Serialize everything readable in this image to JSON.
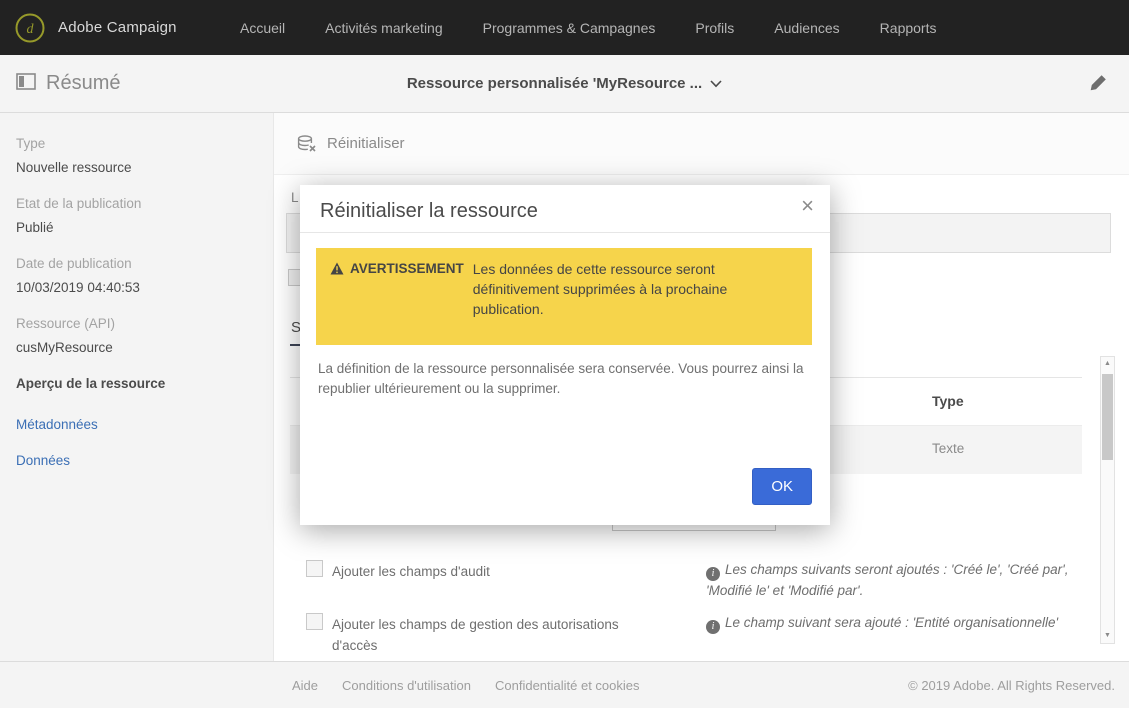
{
  "topbar": {
    "brand": "Adobe Campaign",
    "nav": [
      {
        "label": "Accueil"
      },
      {
        "label": "Activités marketing"
      },
      {
        "label": "Programmes & Campagnes"
      },
      {
        "label": "Profils"
      },
      {
        "label": "Audiences"
      },
      {
        "label": "Rapports"
      }
    ]
  },
  "header": {
    "section": "Résumé",
    "title": "Ressource personnalisée 'MyResource ..."
  },
  "sidebar": {
    "fields": [
      {
        "label": "Type",
        "value": "Nouvelle ressource"
      },
      {
        "label": "Etat de la publication",
        "value": "Publié"
      },
      {
        "label": "Date de publication",
        "value": "10/03/2019 04:40:53"
      },
      {
        "label": "Ressource (API)",
        "value": "cusMyResource"
      }
    ],
    "section_title": "Aperçu de la ressource",
    "links": [
      {
        "label": "Métadonnées"
      },
      {
        "label": "Données"
      }
    ]
  },
  "main": {
    "action": "Réinitialiser",
    "field_label": "L",
    "tab_label": "S",
    "table": {
      "type_header": "Type",
      "type_cell": "Texte"
    },
    "options": [
      {
        "label": "Ajouter les champs d'audit",
        "info": "Les champs suivants seront ajoutés : 'Créé le', 'Créé par', 'Modifié le' et 'Modifié par'."
      },
      {
        "label": "Ajouter les champs de gestion des autorisations d'accès",
        "info": "Le champ suivant sera ajouté : 'Entité organisationnelle'"
      }
    ]
  },
  "modal": {
    "title": "Réinitialiser la ressource",
    "close": "×",
    "warning_label": "AVERTISSEMENT",
    "warning_text": "Les données de cette ressource seront définitivement supprimées à la prochaine publication.",
    "body": "La définition de la ressource personnalisée sera conservée. Vous pourrez ainsi la republier ultérieurement ou la supprimer.",
    "ok_label": "OK"
  },
  "footer": {
    "links": [
      {
        "label": "Aide"
      },
      {
        "label": "Conditions d'utilisation"
      },
      {
        "label": "Confidentialité et cookies"
      }
    ],
    "copyright": "© 2019 Adobe. All Rights Reserved."
  },
  "colors": {
    "topbar_bg": "#222222",
    "accent_blue": "#3a6bd8",
    "warning_yellow": "#f6d44b",
    "link_blue": "#3b6fb5",
    "logo_olive": "#979a2a"
  }
}
